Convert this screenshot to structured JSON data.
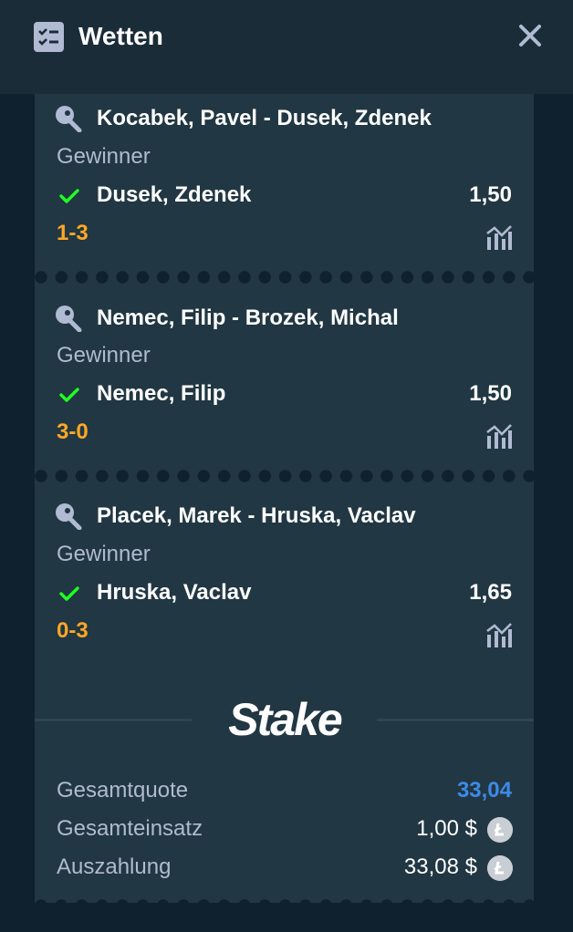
{
  "header": {
    "title": "Wetten",
    "icon": "betslip-icon",
    "close_icon": "close-icon"
  },
  "bets": [
    {
      "match": "Kocabek, Pavel - Dusek, Zdenek",
      "market": "Gewinner",
      "selection": "Dusek, Zdenek",
      "odds": "1,50",
      "score": "1-3",
      "status": "won"
    },
    {
      "match": "Nemec, Filip - Brozek, Michal",
      "market": "Gewinner",
      "selection": "Nemec, Filip",
      "odds": "1,50",
      "score": "3-0",
      "status": "won"
    },
    {
      "match": "Placek, Marek - Hruska, Vaclav",
      "market": "Gewinner",
      "selection": "Hruska, Vaclav",
      "odds": "1,65",
      "score": "0-3",
      "status": "won"
    }
  ],
  "brand": {
    "logo_text": "Stake"
  },
  "summary": {
    "total_odds_label": "Gesamtquote",
    "total_odds": "33,04",
    "total_stake_label": "Gesamteinsatz",
    "total_stake": "1,00 $",
    "payout_label": "Auszahlung",
    "payout": "33,08 $",
    "currency_icon": "litecoin-icon"
  },
  "colors": {
    "background": "#0f212e",
    "card": "#213743",
    "win_check": "#1fff20",
    "score": "#ffa726",
    "total_odds": "#3d8ae6",
    "muted_text": "#b1bad3"
  }
}
